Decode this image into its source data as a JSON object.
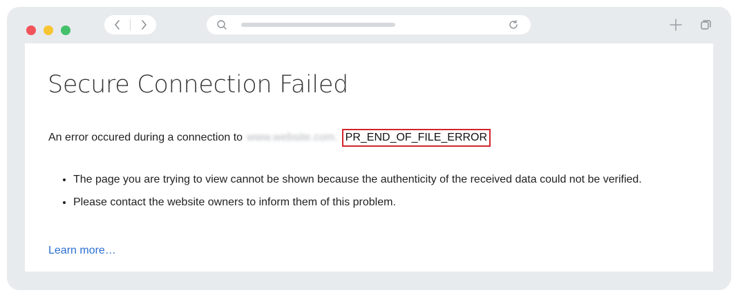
{
  "browser": {
    "traffic_lights": {
      "close_color": "#f2545b",
      "minimize_color": "#f7c531",
      "zoom_color": "#44c06b"
    },
    "nav": {
      "back_icon": "chevron-left-icon",
      "forward_icon": "chevron-right-icon"
    },
    "address_bar": {
      "search_icon": "search-icon",
      "reload_icon": "reload-icon"
    },
    "toolbar": {
      "new_tab_icon": "plus-icon",
      "tabs_icon": "tabs-overview-icon"
    }
  },
  "page": {
    "title": "Secure Connection Failed",
    "error_prefix": "An error occured during a connection to",
    "blurred_host": "www.website.com.",
    "error_code": "PR_END_OF_FILE_ERROR",
    "error_code_highlight_color": "#d3232a",
    "bullets": [
      "The page you are trying to view cannot be shown because the authenticity of the received data could not be verified.",
      "Please contact the website owners to inform them of this problem."
    ],
    "learn_more": "Learn more…",
    "link_color": "#2a6fcf"
  }
}
